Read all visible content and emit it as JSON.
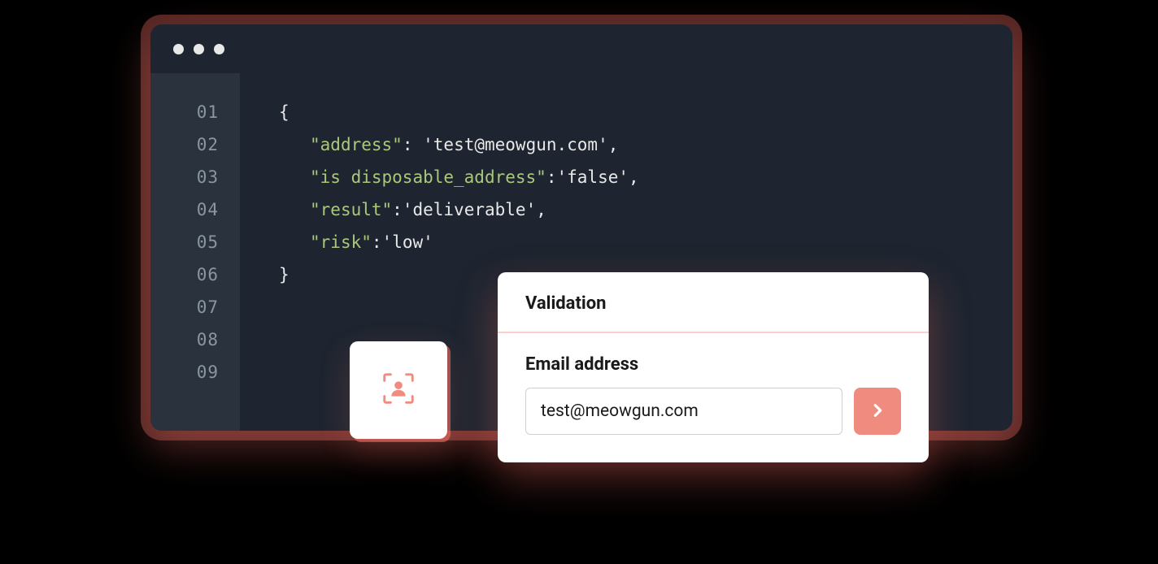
{
  "code": {
    "line_numbers": [
      "01",
      "02",
      "03",
      "04",
      "05",
      "06",
      "07",
      "08",
      "09"
    ],
    "open_brace": "{",
    "close_brace": "}",
    "rows": [
      {
        "key": "address",
        "value": "test@meowgun.com",
        "trailing_comma": ","
      },
      {
        "key": "is disposable_address",
        "value": "false",
        "trailing_comma": ","
      },
      {
        "key": "result",
        "value": "deliverable",
        "trailing_comma": ","
      },
      {
        "key": "risk",
        "value": "low",
        "trailing_comma": ""
      }
    ]
  },
  "validation": {
    "title": "Validation",
    "field_label": "Email address",
    "email_value": "test@meowgun.com"
  },
  "colors": {
    "accent": "#f08b7f",
    "code_key": "#a9c77d"
  }
}
